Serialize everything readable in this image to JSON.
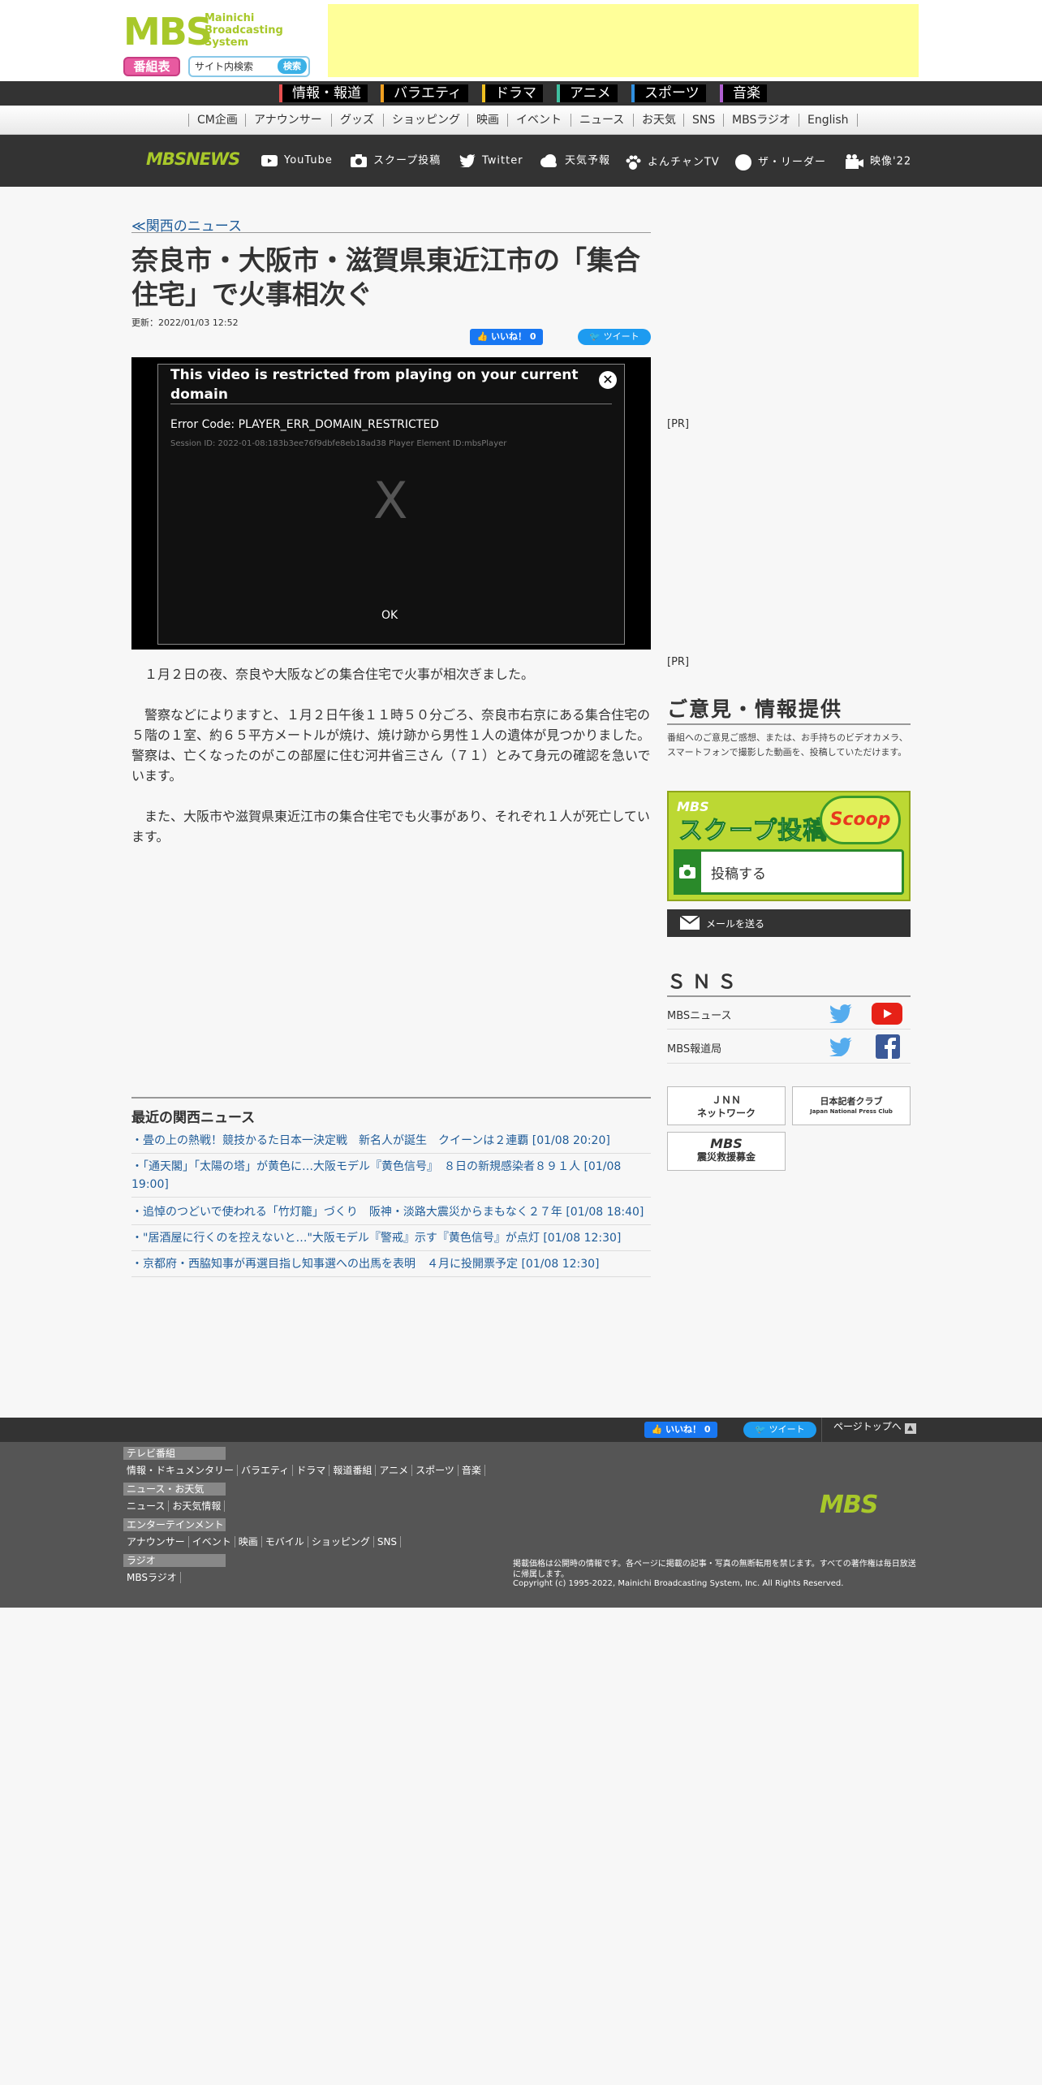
{
  "header": {
    "logo_text": "MBS",
    "logo_sub": [
      "Mainichi",
      "Broadcasting",
      "System"
    ],
    "bangumi_label": "番組表",
    "search_placeholder": "サイト内検索",
    "search_button": "検索"
  },
  "genre_nav": [
    {
      "label": "情報・報道",
      "color": "#e85050"
    },
    {
      "label": "バラエティ",
      "color": "#f0a020"
    },
    {
      "label": "ドラマ",
      "color": "#f0c020"
    },
    {
      "label": "アニメ",
      "color": "#40c0a0"
    },
    {
      "label": "スポーツ",
      "color": "#3090e0"
    },
    {
      "label": "音楽",
      "color": "#b060d0"
    }
  ],
  "sub_nav": [
    "CM企画",
    "アナウンサー",
    "グッズ",
    "ショッピング",
    "映画",
    "イベント",
    "ニュース",
    "お天気",
    "SNS",
    "MBSラジオ",
    "English"
  ],
  "news_bar": {
    "logo": "MBSNEWS",
    "items": [
      {
        "label": "YouTube",
        "icon": "youtube-icon"
      },
      {
        "label": "スクープ投稿",
        "icon": "camera-icon"
      },
      {
        "label": "Twitter",
        "icon": "twitter-icon"
      },
      {
        "label": "天気予報",
        "icon": "cloud-icon"
      },
      {
        "label": "よんチャンTV",
        "icon": "paw-icon"
      },
      {
        "label": "ザ・リーダー",
        "icon": "circle-icon"
      },
      {
        "label": "映像'22",
        "icon": "video-camera-icon"
      }
    ]
  },
  "article": {
    "breadcrumb": "≪関西のニュース",
    "title": "奈良市・大阪市・滋賀県東近江市の「集合住宅」で火事相次ぐ",
    "updated": "更新：2022/01/03 12:52",
    "like_label": "いいね！ 0",
    "tweet_label": "ツイート",
    "paragraphs": [
      "１月２日の夜、奈良や大阪などの集合住宅で火事が相次ぎました。",
      "警察などによりますと、１月２日午後１１時５０分ごろ、奈良市右京にある集合住宅の５階の１室、約６５平方メートルが焼け、焼け跡から男性１人の遺体が見つかりました。警察は、亡くなったのがこの部屋に住む河井省三さん（７１）とみて身元の確認を急いでいます。",
      "また、大阪市や滋賀県東近江市の集合住宅でも火事があり、それぞれ１人が死亡しています。"
    ]
  },
  "video": {
    "title": "This video is restricted from playing on your current domain",
    "error_code": "Error Code: PLAYER_ERR_DOMAIN_RESTRICTED",
    "session": "Session ID: 2022-01-08:183b3ee76f9dbfe8eb18ad38 Player Element ID:mbsPlayer",
    "x_mark": "X",
    "ok_label": "OK"
  },
  "recent": {
    "heading": "最近の関西ニュース",
    "items": [
      "・畳の上の熱戦！競技かるた日本一決定戦　新名人が誕生　クイーンは２連覇 [01/08 20:20]",
      "・「通天閣」「太陽の塔」が黄色に…大阪モデル『黄色信号』　８日の新規感染者８９１人 [01/08 19:00]",
      "・追悼のつどいで使われる「竹灯籠」づくり　阪神・淡路大震災からまもなく２７年 [01/08 18:40]",
      "・\"居酒屋に行くのを控えないと…\"大阪モデル『警戒』示す『黄色信号』が点灯 [01/08 12:30]",
      "・京都府・西脇知事が再選目指し知事選への出馬を表明　４月に投開票予定 [01/08 12:30]"
    ]
  },
  "sidebar": {
    "pr1": "[PR]",
    "pr2": "[PR]",
    "opinion_heading": "ご意見・情報提供",
    "opinion_text": "番組へのご意見ご感想、または、お手持ちのビデオカメラ、スマートフォンで撮影した動画を、投稿していただけます。",
    "scoop_brand": "MBS",
    "scoop_title": "スクープ投稿",
    "scoop_logo": "Scoop",
    "scoop_post": "投稿する",
    "mail_label": "メールを送る",
    "sns_heading": "ＳＮＳ",
    "sns_rows": [
      {
        "name": "MBSニュース",
        "icons": [
          "twitter-icon",
          "youtube-icon"
        ]
      },
      {
        "name": "MBS報道局",
        "icons": [
          "twitter-icon",
          "facebook-icon"
        ]
      }
    ],
    "banners": [
      "ＪＮＮ\nネットワーク",
      "日本記者クラブ",
      "MBS\n震災救援募金"
    ],
    "banner_jnn": "ＪＮＮ",
    "banner_jnn2": "ネットワーク",
    "banner_kisha": "日本記者クラブ",
    "banner_kisha_en": "Japan National Press Club",
    "banner_mbs": "MBS",
    "banner_mbs2": "震災救援募金"
  },
  "footer": {
    "like_label": "いいね！ 0",
    "tweet_label": "ツイート",
    "pagetop": "ページトップへ",
    "categories": [
      {
        "title": "テレビ番組",
        "links": [
          "情報・ドキュメンタリー",
          "バラエティ",
          "ドラマ",
          "報道番組",
          "アニメ",
          "スポーツ",
          "音楽"
        ]
      },
      {
        "title": "ニュース・お天気",
        "links": [
          "ニュース",
          "お天気情報"
        ]
      },
      {
        "title": "エンターテインメント",
        "links": [
          "アナウンサー",
          "イベント",
          "映画",
          "モバイル",
          "ショッピング",
          "SNS"
        ]
      },
      {
        "title": "ラジオ",
        "links": [
          "MBSラジオ"
        ]
      }
    ],
    "logo": "MBS",
    "note": "掲載価格は公開時の情報です。各ページに掲載の記事・写真の無断転用を禁じます。すべての著作権は毎日放送に帰属します。",
    "copyright": "Copyright (c) 1995-2022, Mainichi Broadcasting System, Inc. All Rights Reserved."
  }
}
